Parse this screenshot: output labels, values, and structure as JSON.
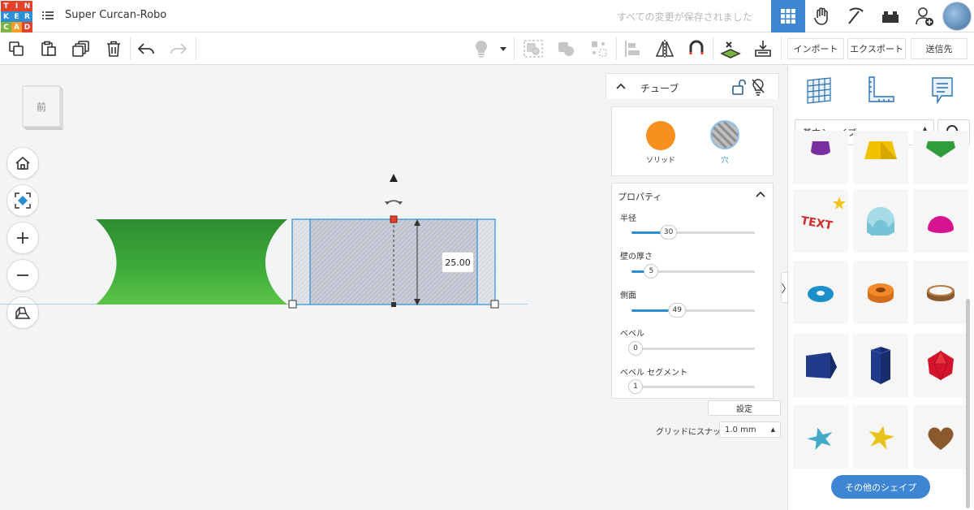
{
  "app": {
    "logo_letters": [
      "T",
      "I",
      "N",
      "K",
      "E",
      "R",
      "C",
      "A",
      "D"
    ],
    "logo_colors": [
      "#e3422a",
      "#e3422a",
      "#e3422a",
      "#2b8fd6",
      "#2b8fd6",
      "#2b8fd6",
      "#7cb342",
      "#f59e2a",
      "#e3422a"
    ],
    "design_title": "Super Curcan-Robo",
    "saved_status": "すべての変更が保存されました"
  },
  "top_icons": [
    {
      "name": "grid-view-icon",
      "active": true
    },
    {
      "name": "glove-icon",
      "active": false
    },
    {
      "name": "pickaxe-icon",
      "active": false
    },
    {
      "name": "bricks-icon",
      "active": false
    },
    {
      "name": "add-user-icon",
      "active": false
    }
  ],
  "toolbar": {
    "import_label": "インポート",
    "export_label": "エクスポート",
    "send_label": "送信先"
  },
  "viewcube": {
    "face_label": "前"
  },
  "dimension": {
    "value": "25.00"
  },
  "inspector": {
    "shape_name": "チューブ",
    "solid_label": "ソリッド",
    "hole_label": "穴",
    "properties_title": "プロパティ",
    "props": [
      {
        "label": "半径",
        "value": "30",
        "fraction": 0.3
      },
      {
        "label": "壁の厚さ",
        "value": "5",
        "fraction": 0.16
      },
      {
        "label": "側面",
        "value": "49",
        "fraction": 0.37
      },
      {
        "label": "ベベル",
        "value": "0",
        "fraction": 0.0
      },
      {
        "label": "ベベル セグメント",
        "value": "1",
        "fraction": 0.0
      }
    ],
    "colors": {
      "solid": "#f7901e",
      "accent": "#2b8fd6"
    }
  },
  "settings_label": "設定",
  "snap": {
    "label": "グリッドにスナップ",
    "value": "1.0 mm"
  },
  "library": {
    "category": "基本シェイプ",
    "more_shapes_label": "その他のシェイプ"
  }
}
